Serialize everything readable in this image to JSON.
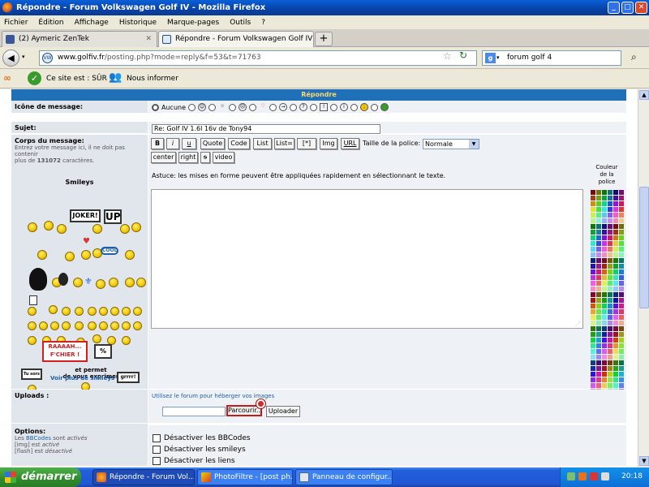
{
  "window": {
    "title": "Répondre - Forum Volkswagen Golf IV - Mozilla Firefox"
  },
  "menu": [
    "Fichier",
    "Édition",
    "Affichage",
    "Historique",
    "Marque-pages",
    "Outils",
    "?"
  ],
  "tabs": [
    {
      "label": "(2) Aymeric ZenTek",
      "color": "#3b5998"
    },
    {
      "label": "Répondre - Forum Volkswagen Golf IV",
      "color": "#1a4c8a"
    }
  ],
  "nav": {
    "url_host": "www.golfiv.fr",
    "url_path": "/posting.php?mode=reply&f=53&t=71763",
    "search_value": "forum golf 4"
  },
  "security": {
    "status": "Ce site est : SÛR",
    "inform": "Nous informer"
  },
  "form": {
    "header": "Répondre",
    "icon_label": "Icône de message:",
    "icon_none": "Aucune",
    "subject_label": "Sujet:",
    "subject_value": "Re: Golf IV 1.6l 16v de Tony94",
    "body_label": "Corps du message:",
    "body_hint_1": "Entrez votre message ici, il ne doit pas contenir",
    "body_hint_2": "plus de",
    "body_hint_count": "131072",
    "body_hint_3": "caractères.",
    "smileys_title": "Smileys",
    "smileys_more": "Voir plus de smileys",
    "toolbar": [
      "B",
      "i",
      "u",
      "Quote",
      "Code",
      "List",
      "List=",
      "[*]",
      "Img",
      "URL"
    ],
    "toolbar2": [
      "center",
      "right",
      "s",
      "video"
    ],
    "font_size_label": "Taille de la police:",
    "font_size_value": "Normale",
    "tip": "Astuce: les mises en forme peuvent être appliquées rapidement en sélectionnant le texte.",
    "color_label_1": "Couleur",
    "color_label_2": "de la",
    "color_label_3": "police",
    "uploads_label": "Uploads :",
    "uploads_link": "Utilisez le forum pour héberger vos images",
    "browse_label": "Parcourir...",
    "upload_label": "Uploader",
    "options_label": "Options:",
    "opt_bbcodes_a": "Les",
    "opt_bbcodes_link": "BBCodes",
    "opt_bbcodes_b": "sont",
    "opt_bbcodes_c": "activés",
    "opt_img_a": "[img]",
    "opt_img_b": "est",
    "opt_img_c": "activé",
    "opt_flash_a": "[flash]",
    "opt_flash_b": "est",
    "opt_flash_c": "désactivé",
    "checkboxes": [
      "Désactiver les BBCodes",
      "Désactiver les smileys",
      "Désactiver les liens"
    ],
    "sign_joker": "JOKER!",
    "sign_up": "UP",
    "sign_cool": "COOL",
    "sign_tusors": "Tu sors",
    "sign_permet_1": "et permet",
    "sign_permet_2": "de vous exprimer",
    "sign_grrr": "grrrr!",
    "sign_raaah_1": "RAAAAH...",
    "sign_raaah_2": "F'CHIER !"
  },
  "taskbar": {
    "start": "démarrer",
    "tasks": [
      "Répondre - Forum Vol...",
      "PhotoFiltre - [post ph...",
      "Panneau de configur..."
    ],
    "clock": "20:18"
  }
}
